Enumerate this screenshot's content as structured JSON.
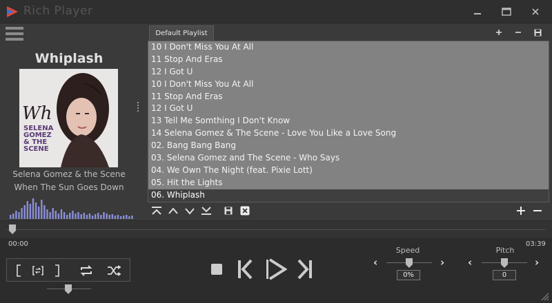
{
  "app": {
    "title": "Rich Player",
    "window_buttons": {
      "minimize": "minimize-icon",
      "maximize": "maximize-icon",
      "close": "close-icon"
    }
  },
  "now_playing": {
    "title": "Whiplash",
    "artist": "Selena Gomez & the Scene",
    "album": "When The Sun Goes Down",
    "cover_text": {
      "line1": "Wh",
      "line2": "SELENA",
      "line3": "GOMEZ",
      "line4": "& THE",
      "line5": "SCENE"
    }
  },
  "playlist": {
    "tab_label": "Default Playlist",
    "header_icons": [
      "add-icon",
      "remove-icon",
      "save-icon"
    ],
    "items": [
      "10 I Don't Miss You At All",
      "11 Stop And Eras",
      "12 I Got U",
      "10 I Don't Miss You At All",
      "11 Stop And Eras",
      "12 I Got U",
      "13 Tell Me Somthing I Don't Know",
      "14 Selena Gomez & The Scene - Love You Like a Love Song",
      "02. Bang Bang Bang",
      "03. Selena Gomez and The Scene - Who Says",
      "04. We Own The Night (feat. Pixie Lott)",
      "05. Hit the Lights",
      "06. Whiplash"
    ],
    "selected_index": 12,
    "toolbar_icons": [
      "move-top-icon",
      "move-up-icon",
      "move-down-icon",
      "move-bottom-icon",
      "save-icon",
      "clear-icon",
      "add-icon",
      "remove-icon"
    ]
  },
  "playback": {
    "elapsed": "00:00",
    "duration": "03:39",
    "seek_position": 0.0,
    "volume": 0.5
  },
  "speed": {
    "label": "Speed",
    "value": "0%",
    "level": 0.5
  },
  "pitch": {
    "label": "Pitch",
    "value": "0",
    "level": 0.5
  },
  "colors": {
    "background": "#2e2e2e",
    "list_bg": "#828282",
    "selected_row": "#3f3f3f",
    "logo_red": "#e2463a",
    "logo_blue": "#3d6fd1",
    "visualizer": "#8b8fd8"
  }
}
